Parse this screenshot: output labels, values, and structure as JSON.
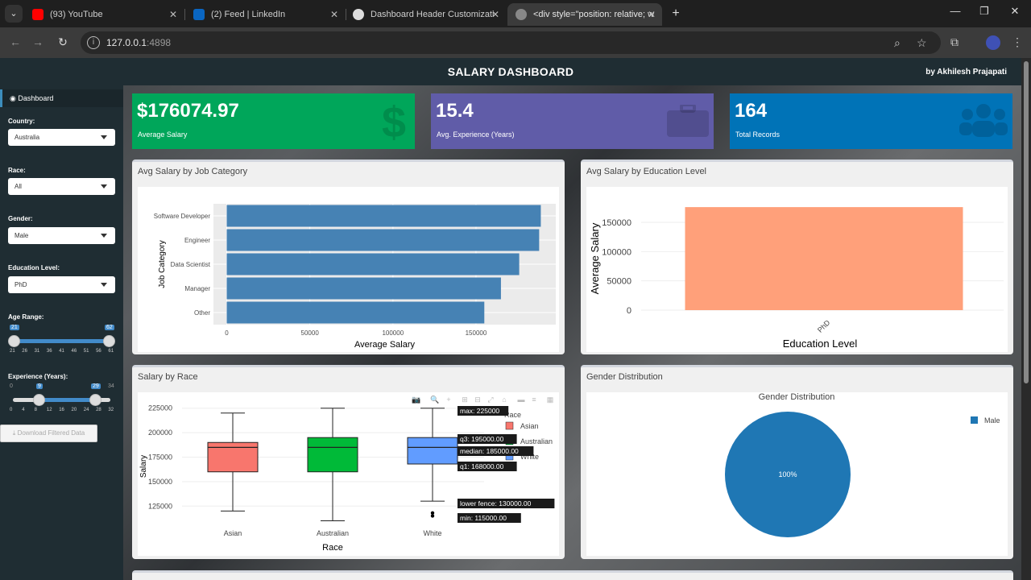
{
  "browser": {
    "tabs": [
      {
        "label": "(93) YouTube",
        "color": "#ff0000"
      },
      {
        "label": "(2) Feed | LinkedIn",
        "color": "#0a66c2"
      },
      {
        "label": "Dashboard Header Customizati",
        "color": "#dddddd"
      },
      {
        "label": "<div style=\"position: relative; w",
        "color": "#888888"
      }
    ],
    "url_host": "127.0.0.1",
    "url_port": ":4898"
  },
  "header": {
    "title": "SALARY DASHBOARD",
    "byline": "by Akhilesh Prajapati"
  },
  "sidebar": {
    "menu_item": "Dashboard",
    "country_label": "Country:",
    "country_value": "Australia",
    "race_label": "Race:",
    "race_value": "All",
    "gender_label": "Gender:",
    "gender_value": "Male",
    "education_label": "Education Level:",
    "education_value": "PhD",
    "age_label": "Age Range:",
    "age_min": "21",
    "age_max": "62",
    "age_ticks": [
      "21",
      "26",
      "31",
      "36",
      "41",
      "46",
      "51",
      "56",
      "61"
    ],
    "exp_label": "Experience (Years):",
    "exp_low": "0",
    "exp_from": "9",
    "exp_to": "29",
    "exp_high": "34",
    "exp_ticks": [
      "0",
      "4",
      "8",
      "12",
      "16",
      "20",
      "24",
      "28",
      "32"
    ],
    "download_label": "Download Filtered Data"
  },
  "kpis": [
    {
      "value": "$176074.97",
      "label": "Average Salary",
      "color": "#00a65a",
      "icon": "dollar-icon"
    },
    {
      "value": "15.4",
      "label": "Avg. Experience (Years)",
      "color": "#605ca8",
      "icon": "briefcase-icon"
    },
    {
      "value": "164",
      "label": "Total Records",
      "color": "#0073b7",
      "icon": "users-icon"
    }
  ],
  "boxes": {
    "job": "Avg Salary by Job Category",
    "edu": "Avg Salary by Education Level",
    "race": "Salary by Race",
    "gender": "Gender Distribution"
  },
  "chart_data": [
    {
      "type": "bar",
      "orientation": "horizontal",
      "title": "",
      "xlabel": "Average Salary",
      "ylabel": "Job Category",
      "categories": [
        "Software Developer",
        "Engineer",
        "Data Scientist",
        "Manager",
        "Other"
      ],
      "values": [
        189000,
        188000,
        176000,
        165000,
        155000
      ],
      "xlim": [
        -8000,
        198000
      ],
      "xticks": [
        "0",
        "50000",
        "100000",
        "150000"
      ],
      "color": "#4682b4",
      "grid": true
    },
    {
      "type": "bar",
      "title": "",
      "xlabel": "Education Level",
      "ylabel": "Average Salary",
      "categories": [
        "PhD"
      ],
      "values": [
        176075
      ],
      "ylim": [
        0,
        190000
      ],
      "yticks": [
        "0",
        "50000",
        "100000",
        "150000"
      ],
      "color": "#ffa07a",
      "grid": true
    },
    {
      "type": "box",
      "title": "",
      "xlabel": "Race",
      "ylabel": "Salary",
      "legend_title": "Race",
      "categories": [
        "Asian",
        "Australian",
        "White"
      ],
      "ylim": [
        103000,
        233000
      ],
      "yticks": [
        "125000",
        "150000",
        "175000",
        "200000",
        "225000"
      ],
      "series": [
        {
          "name": "Asian",
          "color": "#f8766d",
          "min": 120000,
          "q1": 160000,
          "median": 185000,
          "q3": 190000,
          "max": 220000,
          "outliers": []
        },
        {
          "name": "Australian",
          "color": "#00ba38",
          "min": 110000,
          "q1": 160000,
          "median": 185000,
          "q3": 195000,
          "max": 225000,
          "outliers": []
        },
        {
          "name": "White",
          "color": "#619cff",
          "min": 130000,
          "q1": 168000,
          "median": 185000,
          "q3": 195000,
          "max": 225000,
          "outliers": [
            115000,
            118000
          ]
        }
      ],
      "hover_labels": [
        "max: 225000",
        "q3: 195000.00",
        "median: 185000.00",
        "q1: 168000.00",
        "lower fence: 130000.00",
        "min: 115000.00"
      ]
    },
    {
      "type": "pie",
      "title": "Gender Distribution",
      "labels": [
        "Male"
      ],
      "values": [
        100
      ],
      "slice_labels": [
        "100%"
      ],
      "colors": [
        "#1f77b4"
      ],
      "legend": "top-right"
    }
  ]
}
